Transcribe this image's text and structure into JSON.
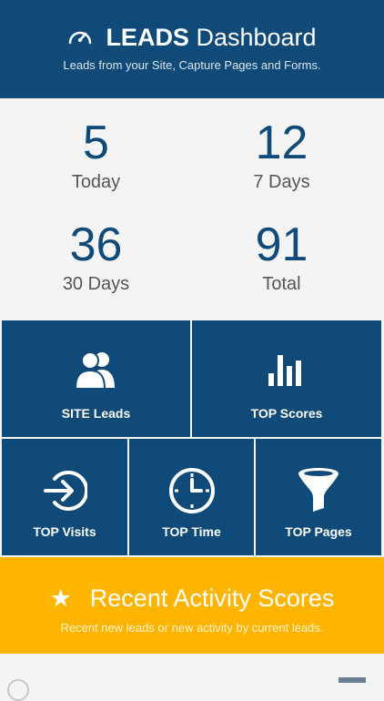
{
  "header": {
    "title_strong": "LEADS",
    "title_rest": "Dashboard",
    "subtitle": "Leads from your Site, Capture Pages and Forms.",
    "icon": "speedometer-icon"
  },
  "stats": [
    {
      "value": "5",
      "label": "Today"
    },
    {
      "value": "12",
      "label": "7 Days"
    },
    {
      "value": "36",
      "label": "30 Days"
    },
    {
      "value": "91",
      "label": "Total"
    }
  ],
  "tiles": {
    "site_leads": {
      "label": "SITE Leads",
      "icon": "users-icon"
    },
    "top_scores": {
      "label": "TOP Scores",
      "icon": "bar-chart-icon"
    },
    "top_visits": {
      "label": "TOP Visits",
      "icon": "sign-in-arrow-icon"
    },
    "top_time": {
      "label": "TOP Time",
      "icon": "clock-icon"
    },
    "top_pages": {
      "label": "TOP Pages",
      "icon": "funnel-icon"
    }
  },
  "banner": {
    "star": "★",
    "title": "Recent Activity Scores",
    "subtitle": "Recent new leads or new activity by current leads."
  },
  "colors": {
    "primary": "#0f4a78",
    "accent": "#ffb400",
    "background": "#f4f4f4"
  }
}
